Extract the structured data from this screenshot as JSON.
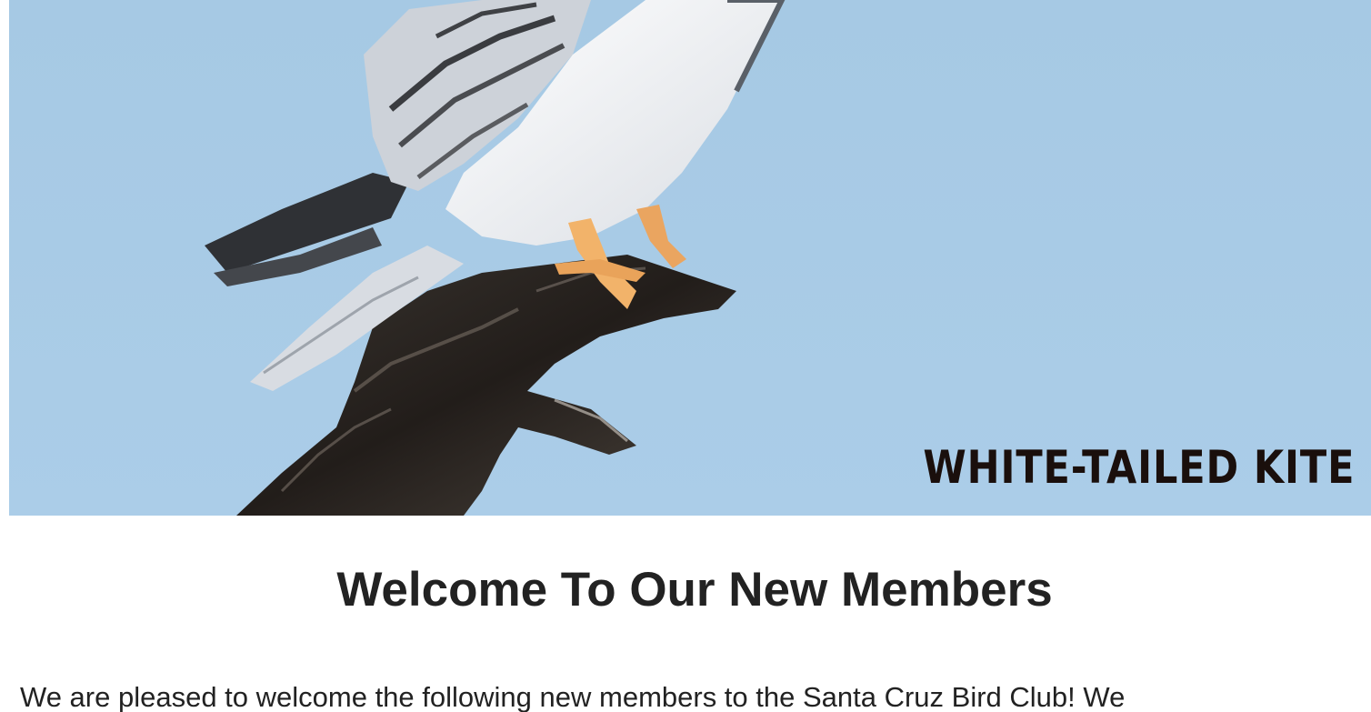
{
  "hero": {
    "caption": "WHITE-TAILED KITE",
    "sky_color": "#a8cbe6"
  },
  "section": {
    "heading": "Welcome To Our New Members",
    "intro": "We are pleased to welcome the following new members to the Santa Cruz Bird Club! We"
  }
}
